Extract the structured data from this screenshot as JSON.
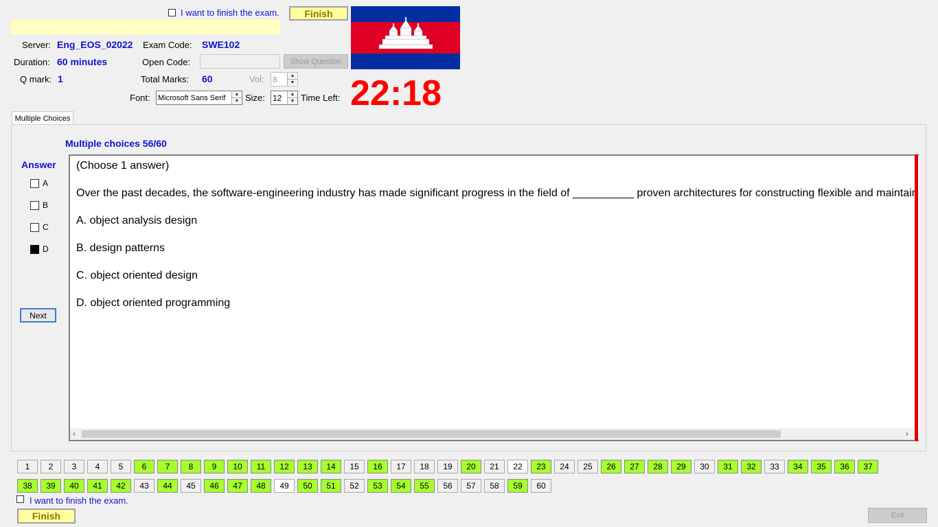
{
  "header": {
    "finish_check_label": "I want to finish the exam.",
    "finish_button": "Finish",
    "server_label": "Server:",
    "server_value": "Eng_EOS_02022",
    "exam_code_label": "Exam Code:",
    "exam_code_value": "SWE102",
    "duration_label": "Duration:",
    "duration_value": "60 minutes",
    "open_code_label": "Open Code:",
    "open_code_value": "",
    "show_question_button": "Show Question",
    "qmark_label": "Q mark:",
    "qmark_value": "1",
    "total_marks_label": "Total Marks:",
    "total_marks_value": "60",
    "vol_label": "Vol:",
    "vol_value": "8",
    "font_label": "Font:",
    "font_value": "Microsoft Sans Serif",
    "size_label": "Size:",
    "size_value": "12",
    "time_left_label": "Time Left:",
    "time_left_value": "22:18"
  },
  "flag": {
    "top_color": "#032ea1",
    "middle_color": "#e00025",
    "bottom_color": "#032ea1"
  },
  "tab": {
    "label": "Multiple Choices"
  },
  "question": {
    "heading": "Multiple choices 56/60",
    "instruction": "(Choose 1 answer)",
    "text": "Over the past decades, the software-engineering industry has made significant progress in the field of  __________ proven architectures for constructing flexible and maintain",
    "options": [
      "A.  object analysis design",
      "B.  design patterns",
      "C.  object oriented design",
      "D.  object oriented programming"
    ]
  },
  "answer": {
    "heading": "Answer",
    "choices": [
      {
        "label": "A",
        "checked": false
      },
      {
        "label": "B",
        "checked": false
      },
      {
        "label": "C",
        "checked": false
      },
      {
        "label": "D",
        "checked": true
      }
    ],
    "next_button": "Next"
  },
  "questions_nav": {
    "answered": [
      6,
      7,
      8,
      9,
      10,
      11,
      12,
      13,
      14,
      16,
      20,
      23,
      26,
      27,
      28,
      29,
      31,
      32,
      34,
      35,
      36,
      37,
      38,
      39,
      40,
      41,
      42,
      44,
      46,
      47,
      48,
      50,
      51,
      53,
      54,
      55,
      59
    ],
    "current": [
      22,
      49
    ],
    "total": 60
  },
  "footer": {
    "finish_check_label": "I want to finish the exam.",
    "finish_button": "Finish",
    "exit_button": "Exit"
  },
  "colors": {
    "answered": "#a6ff2e",
    "accent_blue": "#1212d0",
    "timer_red": "#ff0000",
    "scroll_marker": "#e00000"
  }
}
